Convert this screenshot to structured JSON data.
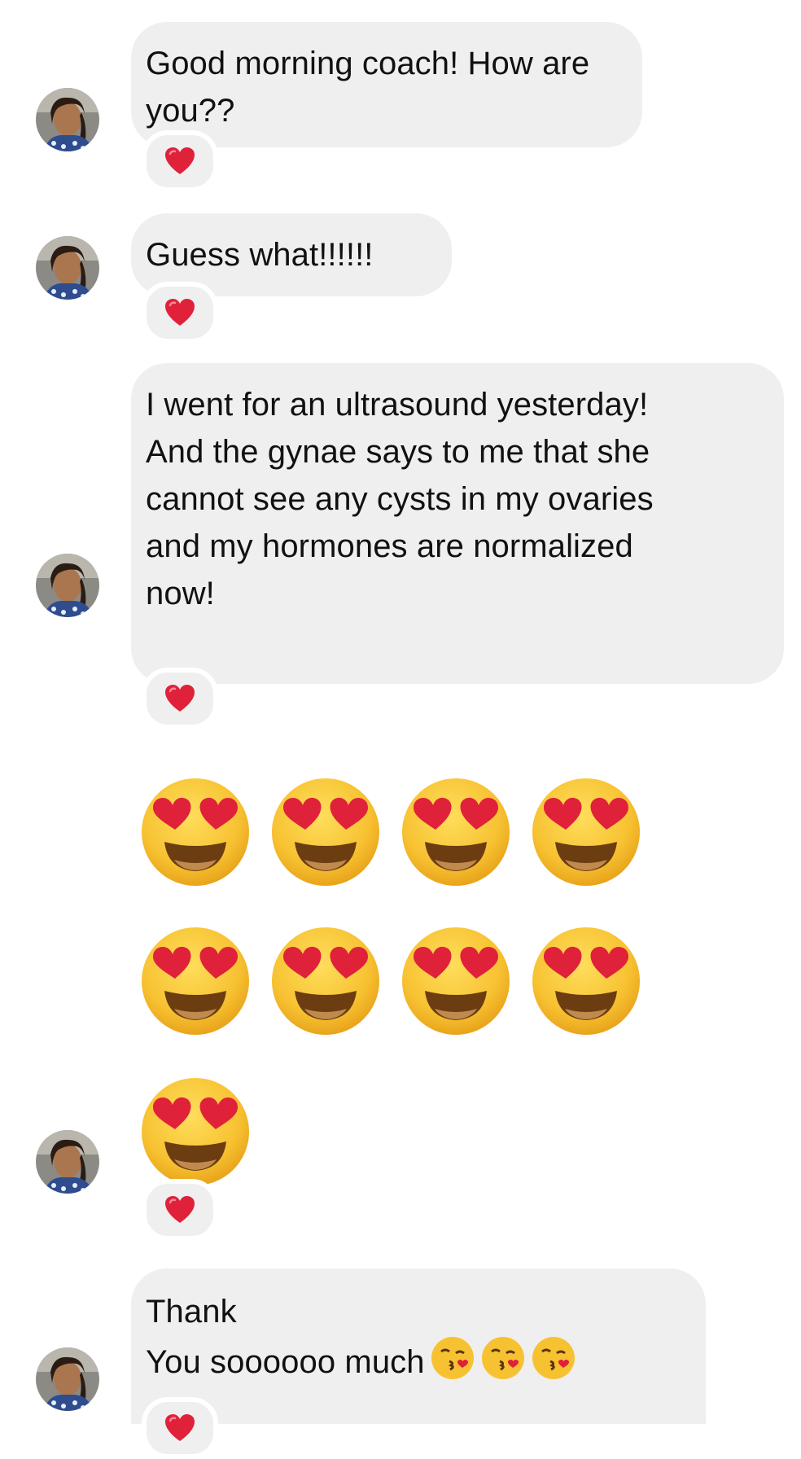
{
  "conversation": {
    "messages": [
      {
        "lines": [
          "Good morning coach! How are",
          "you??"
        ],
        "reaction": "red-heart"
      },
      {
        "lines": [
          "Guess what!!!!!!"
        ],
        "reaction": "red-heart"
      },
      {
        "lines": [
          "I went for an ultrasound yesterday!",
          "And the gynae says to me that she",
          "cannot see any cysts in my ovaries",
          "and my hormones are normalized",
          "now!"
        ],
        "reaction": "red-heart"
      },
      {
        "emoji_message": {
          "emoji": "smiling-face-with-heart-eyes",
          "count": 9
        },
        "reaction": "red-heart"
      },
      {
        "lines": [
          "Thank",
          "You soooooo much"
        ],
        "trailing_emoji": "face-blowing-a-kiss",
        "trailing_emoji_count": 3,
        "reaction": "red-heart"
      }
    ]
  },
  "colors": {
    "bubble_background": "#efefef",
    "heart": "#e0213a",
    "emoji_face": "#f7c232"
  }
}
